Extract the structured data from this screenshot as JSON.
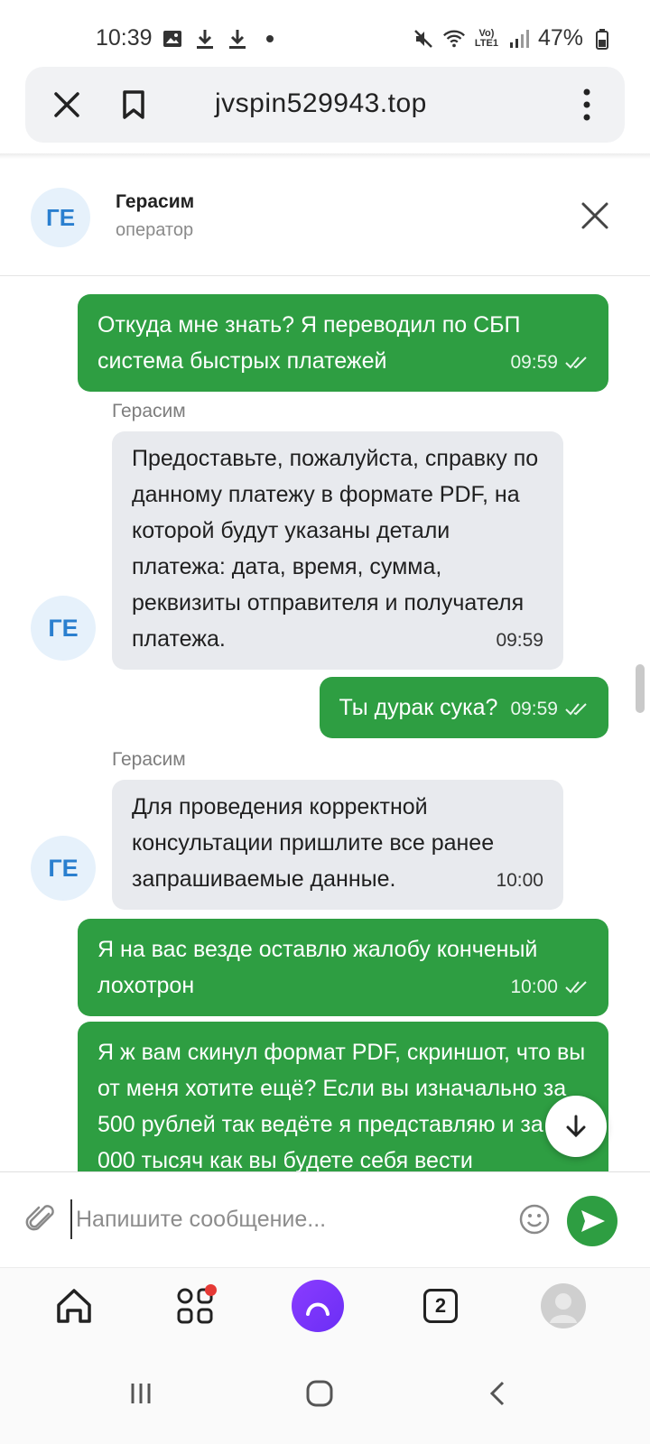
{
  "status_bar": {
    "time": "10:39",
    "battery": "47%",
    "network": "LTE1",
    "icons": [
      "image-icon",
      "download-icon",
      "download-icon",
      "dot-icon",
      "mute-icon",
      "wifi-icon",
      "lte-icon",
      "signal-icon",
      "battery-icon"
    ]
  },
  "browser": {
    "url": "jvspin529943.top"
  },
  "chat_header": {
    "avatar_initials": "ГЕ",
    "name": "Герасим",
    "role": "оператор"
  },
  "messages": [
    {
      "direction": "out",
      "text": "Откуда мне знать? Я переводил по СБП система быстрых платежей",
      "time": "09:59",
      "read": true
    },
    {
      "direction": "in",
      "sender": "Герасим",
      "avatar": "ГЕ",
      "text": "Предоставьте, пожалуйста, справку по данному платежу в формате PDF, на которой будут указаны детали платежа: дата, время, сумма, реквизиты отправителя и получателя платежа.",
      "time": "09:59"
    },
    {
      "direction": "out",
      "text": "Ты дурак сука?",
      "time": "09:59",
      "read": true
    },
    {
      "direction": "in",
      "sender": "Герасим",
      "avatar": "ГЕ",
      "text": "Для проведения корректной консультации пришлите все ранее запрашиваемые данные.",
      "time": "10:00"
    },
    {
      "direction": "out",
      "text": "Я на вас везде оставлю жалобу конченый лохотрон",
      "time": "10:00",
      "read": true
    },
    {
      "direction": "out",
      "text": "Я ж вам скинул формат PDF, скриншот, что вы от меня хотите ещё? Если вы изначально за 500 рублей так ведёте я представляю и за 50 000 тысяч как вы будете себя вести",
      "time": "",
      "read": false
    }
  ],
  "composer": {
    "placeholder": "Напишите сообщение..."
  },
  "bottom_nav": {
    "tabs_count": "2"
  },
  "colors": {
    "outgoing_bubble": "#2e9e42",
    "incoming_bubble": "#e8eaee",
    "avatar_bg": "#e6f1fb",
    "avatar_text": "#2a7fcf",
    "alice_purple": "#7b35f8"
  }
}
